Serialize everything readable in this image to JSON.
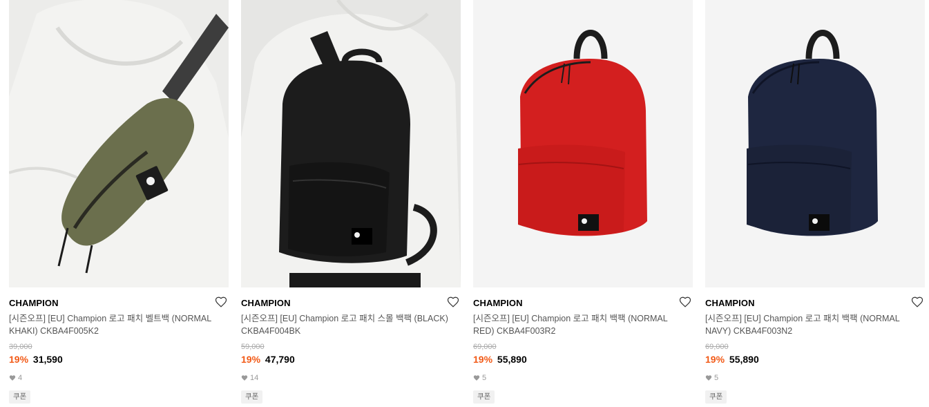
{
  "products": [
    {
      "brand": "CHAMPION",
      "title": "[시즌오프] [EU] Champion 로고 패치 벨트백 (NORMAL KHAKI) CKBA4F005K2",
      "original_price": "39,000",
      "discount": "19%",
      "price": "31,590",
      "likes": "4",
      "coupon": "쿠폰",
      "image": "khaki-belt-bag-photo",
      "bag_color": "#6b6f4d"
    },
    {
      "brand": "CHAMPION",
      "title": "[시즌오프] [EU] Champion 로고 패치 스몰 백팩 (BLACK) CKBA4F004BK",
      "original_price": "59,000",
      "discount": "19%",
      "price": "47,790",
      "likes": "14",
      "coupon": "쿠폰",
      "image": "black-backpack-photo",
      "bag_color": "#1c1c1c"
    },
    {
      "brand": "CHAMPION",
      "title": "[시즌오프] [EU] Champion 로고 패치 백팩 (NORMAL RED) CKBA4F003R2",
      "original_price": "69,000",
      "discount": "19%",
      "price": "55,890",
      "likes": "5",
      "coupon": "쿠폰",
      "image": "red-backpack-photo",
      "bag_color": "#d31f1f"
    },
    {
      "brand": "CHAMPION",
      "title": "[시즌오프] [EU] Champion 로고 패치 백팩 (NORMAL NAVY) CKBA4F003N2",
      "original_price": "69,000",
      "discount": "19%",
      "price": "55,890",
      "likes": "5",
      "coupon": "쿠폰",
      "image": "navy-backpack-photo",
      "bag_color": "#1e2640"
    }
  ],
  "colors": {
    "discount": "#f25a17",
    "muted": "#999999",
    "title": "#555555"
  },
  "icons": {
    "wishlist": "heart-outline-icon",
    "likes": "heart-filled-icon"
  }
}
